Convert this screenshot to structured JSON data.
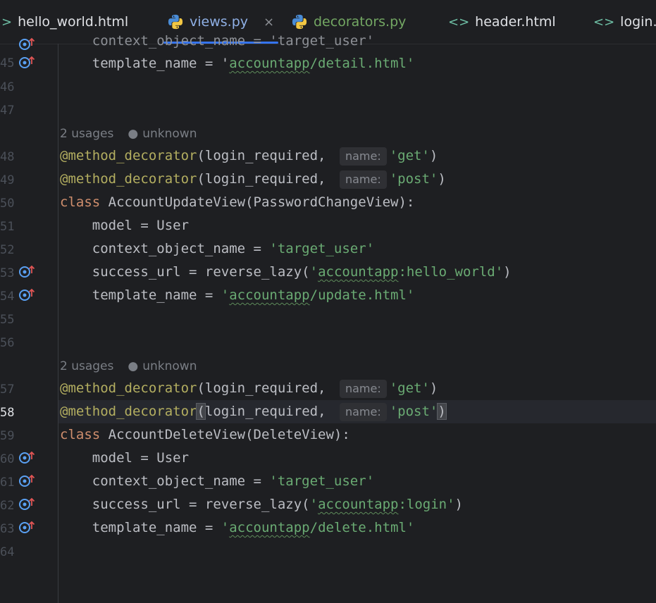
{
  "tabs": [
    {
      "label": "hello_world.html",
      "type": "html",
      "active": false
    },
    {
      "label": "views.py",
      "type": "python",
      "active": true
    },
    {
      "label": "decorators.py",
      "type": "python",
      "active": false
    },
    {
      "label": "header.html",
      "type": "html",
      "active": false
    },
    {
      "label": "login.h",
      "type": "html",
      "active": false
    }
  ],
  "icons": {
    "html_tab_icon": "chevron-brackets-icon",
    "python_tab_icon": "python-icon",
    "close_tab_icon": "close-icon",
    "gutter_override_icon": "override-method-icon",
    "author_icon": "person-icon",
    "close_glyph": "×",
    "html_glyph": "<>",
    "chev_glyph": ">"
  },
  "colors": {
    "background": "#1e1f22",
    "accent": "#3574f0",
    "decorator": "#b3ae60",
    "keyword": "#cf8e6d",
    "string": "#6aab73",
    "text": "#bcbec4"
  },
  "gutter": {
    "line_numbers": [
      "45",
      "46",
      "47",
      "48",
      "49",
      "50",
      "51",
      "52",
      "53",
      "54",
      "55",
      "56",
      "57",
      "58",
      "59",
      "60",
      "61",
      "62",
      "63",
      "64"
    ],
    "current_line": "58"
  },
  "inlay": {
    "usages_1": "2 usages",
    "author_1": "unknown",
    "usages_2": "2 usages",
    "author_2": "unknown",
    "name_hint": "name:"
  },
  "code": {
    "l44": "    context_object_name = 'target_user'",
    "l45_a": "    template_name = '",
    "l45_b": "accountapp",
    "l45_c": "/detail.html'",
    "l48_dec": "@method_decorator",
    "l48_a": "(login_required, ",
    "l48_s": "'get'",
    "l48_e": ")",
    "l49_dec": "@method_decorator",
    "l49_a": "(login_required, ",
    "l49_s": "'post'",
    "l49_e": ")",
    "l50_kw": "class",
    "l50_a": " AccountUpdateView(PasswordChangeView):",
    "l51": "    model = User",
    "l52_a": "    context_object_name = ",
    "l52_s": "'target_user'",
    "l53_a": "    success_url = reverse_lazy(",
    "l53_s1": "'",
    "l53_w": "accountapp",
    "l53_s2": ":hello_world'",
    "l53_e": ")",
    "l54_a": "    template_name = ",
    "l54_s1": "'",
    "l54_w": "accountapp",
    "l54_s2": "/update.html'",
    "l57_dec": "@method_decorator",
    "l57_a": "(login_required, ",
    "l57_s": "'get'",
    "l57_e": ")",
    "l58_dec": "@method_decorator",
    "l58_p": "(",
    "l58_a": "login_required, ",
    "l58_s": "'post'",
    "l58_e": ")",
    "l59_kw": "class",
    "l59_a": " AccountDeleteView(DeleteView):",
    "l60": "    model = User",
    "l61_a": "    context_object_name = ",
    "l61_s": "'target_user'",
    "l62_a": "    success_url = reverse_lazy(",
    "l62_s1": "'",
    "l62_w": "accountapp",
    "l62_s2": ":login'",
    "l62_e": ")",
    "l63_a": "    template_name = ",
    "l63_s1": "'",
    "l63_w": "accountapp",
    "l63_s2": "/delete.html'"
  }
}
